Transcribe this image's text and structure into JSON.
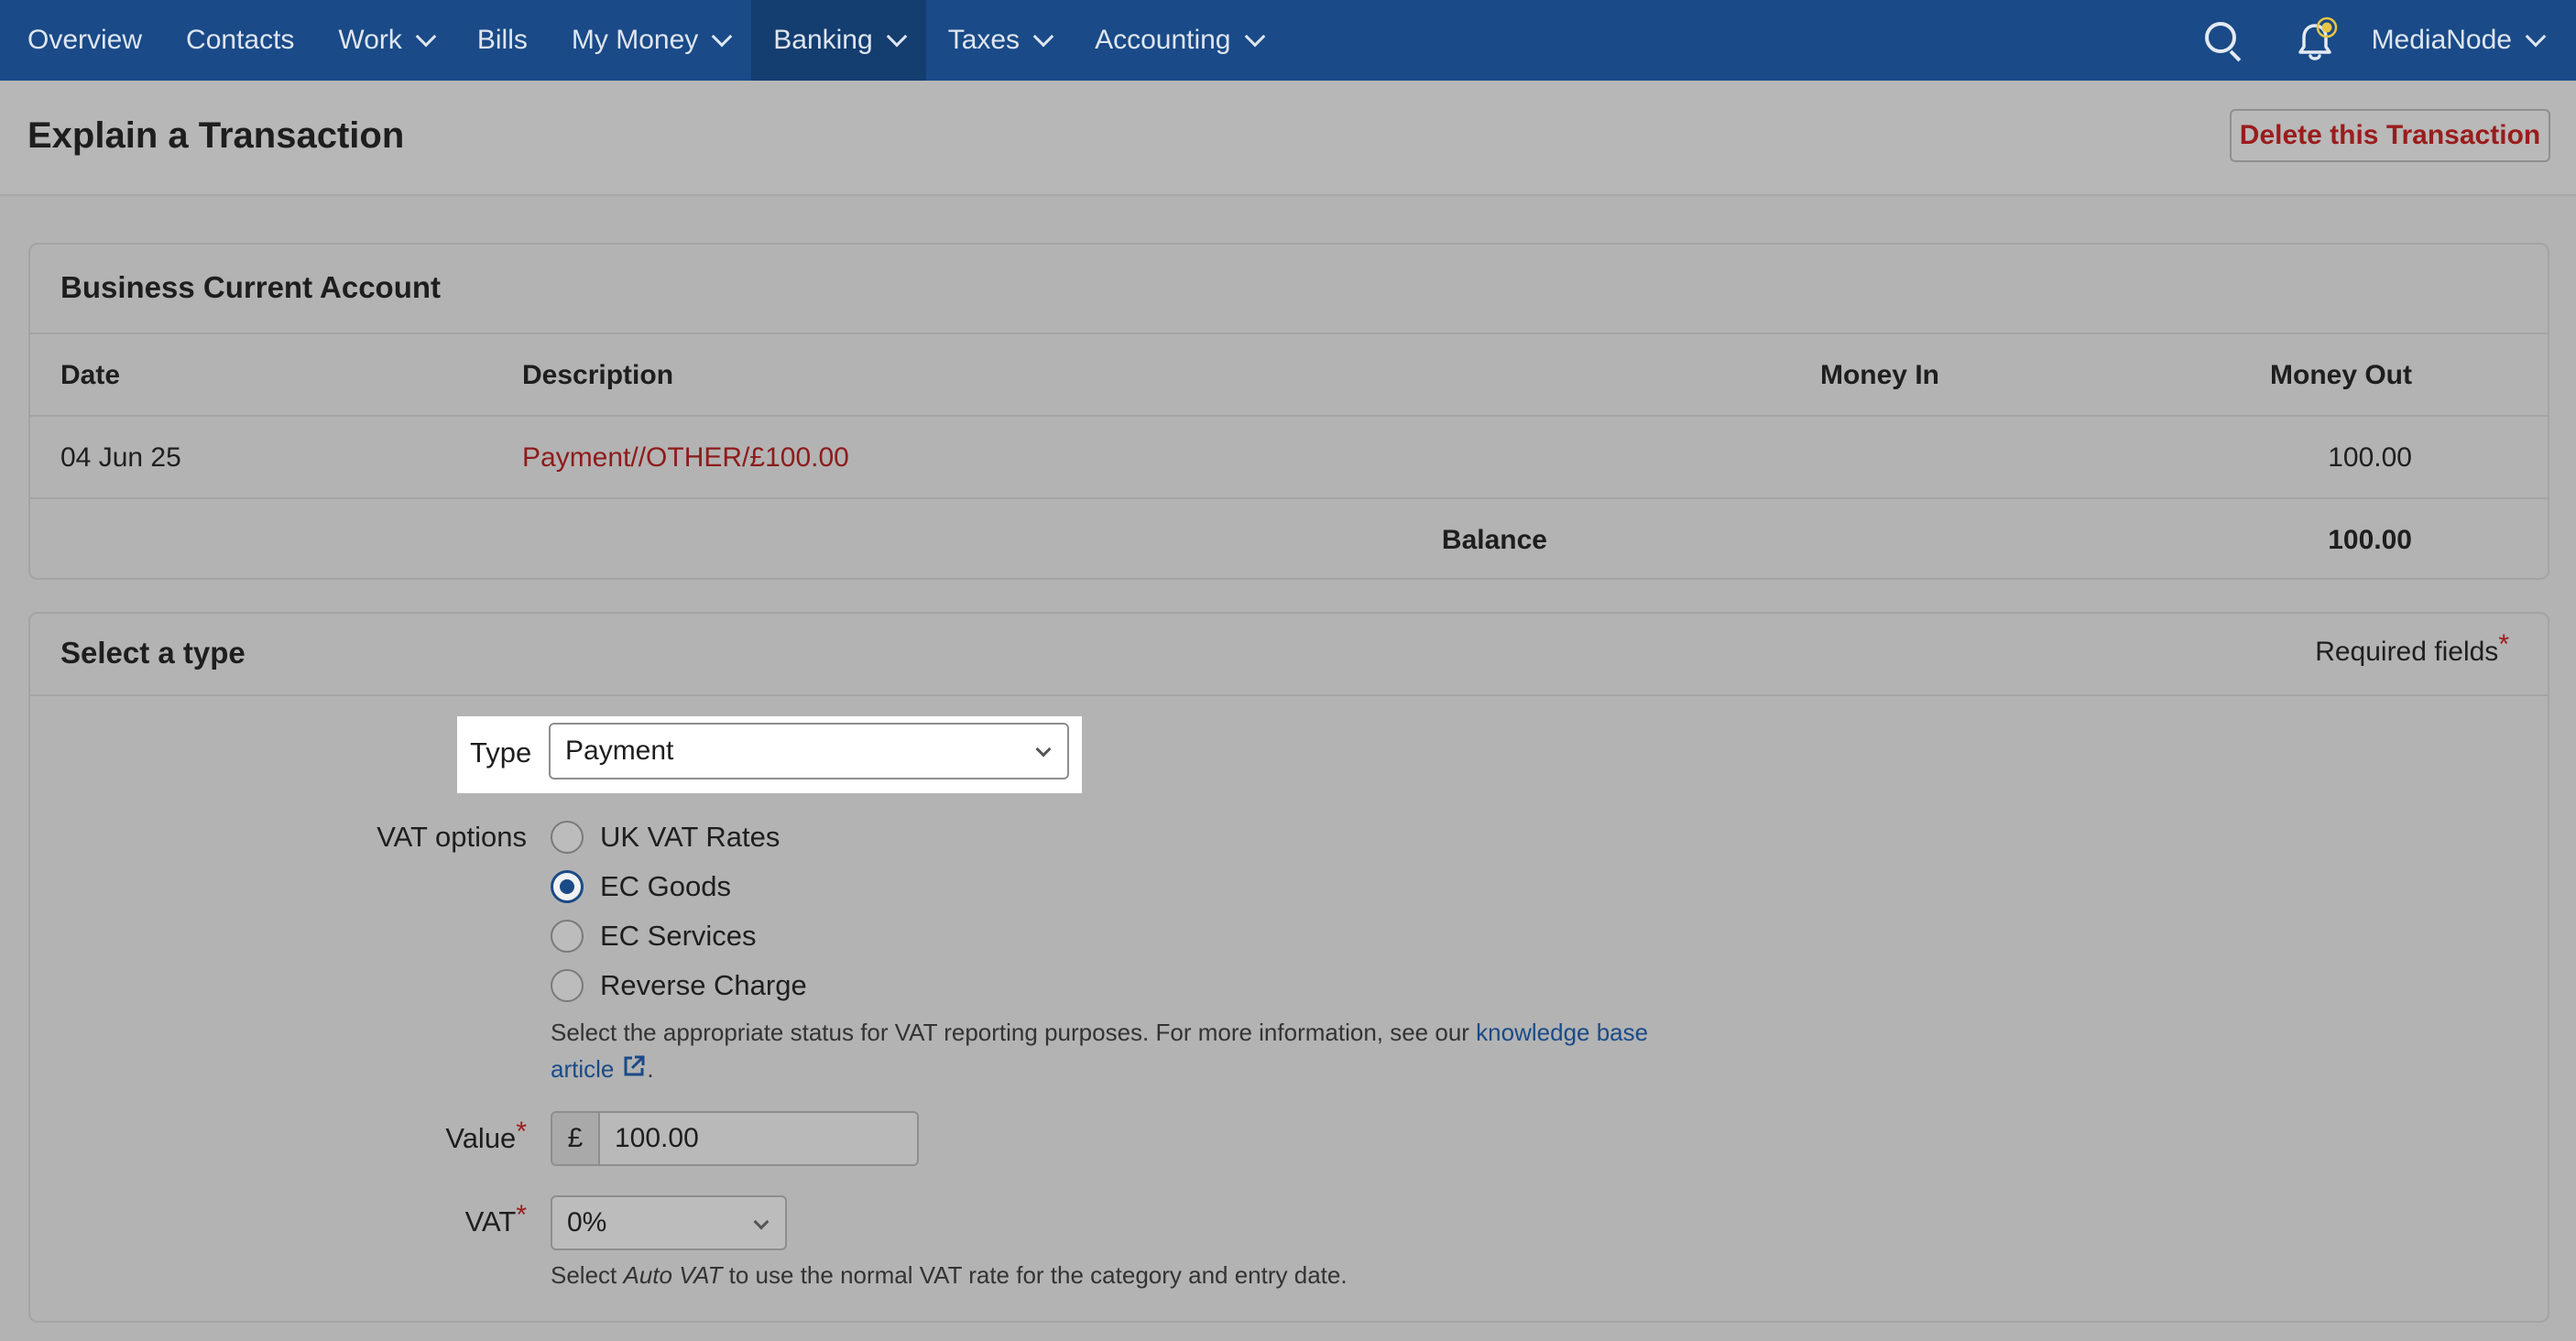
{
  "nav": {
    "items": [
      {
        "label": "Overview",
        "dropdown": false
      },
      {
        "label": "Contacts",
        "dropdown": false
      },
      {
        "label": "Work",
        "dropdown": true
      },
      {
        "label": "Bills",
        "dropdown": false
      },
      {
        "label": "My Money",
        "dropdown": true
      },
      {
        "label": "Banking",
        "dropdown": true,
        "active": true
      },
      {
        "label": "Taxes",
        "dropdown": true
      },
      {
        "label": "Accounting",
        "dropdown": true
      }
    ],
    "user_label": "MediaNode",
    "icons": {
      "search": "search-icon",
      "notifications": "bell-icon",
      "chevron": "chevron-down-icon"
    },
    "colors": {
      "background": "#1a4a87",
      "active": "#143d70",
      "notification_dot": "#e8c547"
    }
  },
  "header": {
    "title": "Explain a Transaction",
    "delete_label": "Delete this Transaction"
  },
  "account": {
    "title": "Business Current Account",
    "columns": {
      "date": "Date",
      "description": "Description",
      "money_in": "Money In",
      "money_out": "Money Out"
    },
    "rows": [
      {
        "date": "04 Jun 25",
        "description": "Payment//OTHER/£100.00",
        "money_in": "",
        "money_out": "100.00"
      }
    ],
    "balance_label": "Balance",
    "balance_value": "100.00"
  },
  "type_section": {
    "title": "Select a type",
    "required_note": "Required fields",
    "required_marker": "*",
    "type_label": "Type",
    "type_value": "Payment",
    "vat_options_label": "VAT options",
    "vat_options": [
      {
        "label": "UK VAT Rates",
        "checked": false
      },
      {
        "label": "EC Goods",
        "checked": true
      },
      {
        "label": "EC Services",
        "checked": false
      },
      {
        "label": "Reverse Charge",
        "checked": false
      }
    ],
    "vat_help_prefix": "Select the appropriate status for VAT reporting purposes. For more information, see our ",
    "vat_help_link_1": "knowledge base",
    "vat_help_link_2": "article",
    "vat_help_suffix": ".",
    "value_label": "Value",
    "currency_symbol": "£",
    "value": "100.00",
    "vat_label": "VAT",
    "vat_value": "0%",
    "vat_hint_prefix": "Select ",
    "vat_hint_em": "Auto VAT",
    "vat_hint_suffix": " to use the normal VAT rate for the category and entry date."
  }
}
